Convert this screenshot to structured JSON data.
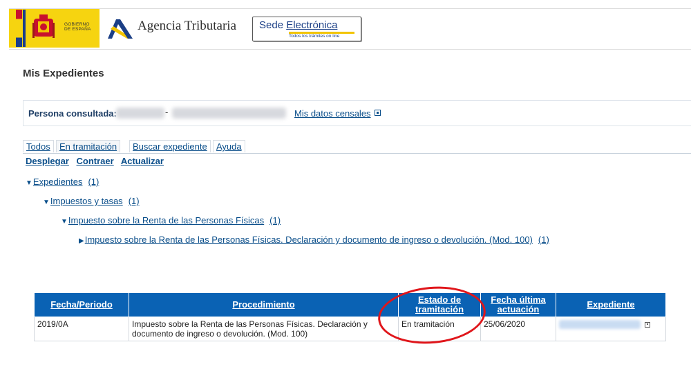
{
  "header": {
    "gob_line1": "GOBIERNO",
    "gob_line2": "DE ESPAÑA",
    "agency": "Agencia Tributaria",
    "sede_word1": "Sede ",
    "sede_word2": "Electrónica",
    "sede_tagline": "Todos los trámites on line"
  },
  "page_title": "Mis Expedientes",
  "persona": {
    "label": "Persona consultada:",
    "separator": "-",
    "censales_link": "Mis datos censales"
  },
  "tabs": [
    {
      "label": "Todos"
    },
    {
      "label": "En tramitación"
    },
    {
      "label": "Buscar expediente"
    },
    {
      "label": "Ayuda"
    }
  ],
  "actions": [
    "Desplegar",
    "Contraer",
    "Actualizar"
  ],
  "tree": [
    {
      "arrow": "▼",
      "label": "Expedientes",
      "count": "(1)"
    },
    {
      "arrow": "▼",
      "label": "Impuestos y tasas",
      "count": "(1)"
    },
    {
      "arrow": "▼",
      "label": "Impuesto sobre la Renta de las Personas Físicas",
      "count": "(1)"
    },
    {
      "arrow": "▶",
      "label": "Impuesto sobre la Renta de las Personas Físicas. Declaración y documento de ingreso o devolución. (Mod. 100)",
      "count": "(1)"
    }
  ],
  "table": {
    "headers": [
      "Fecha/Periodo",
      "Procedimiento",
      "Estado de tramitación",
      "Fecha última actuación",
      "Expediente"
    ],
    "rows": [
      {
        "fecha": "2019/0A",
        "procedimiento": "Impuesto sobre la Renta de las Personas Físicas. Declaración y documento de ingreso o devolución. (Mod. 100)",
        "estado": "En tramitación",
        "fecha_ultima": "25/06/2020"
      }
    ]
  },
  "colors": {
    "link": "#0a4e8a",
    "table_header": "#0a62b4",
    "highlight_circle": "#e0161b",
    "gob_yellow": "#f6d410"
  }
}
